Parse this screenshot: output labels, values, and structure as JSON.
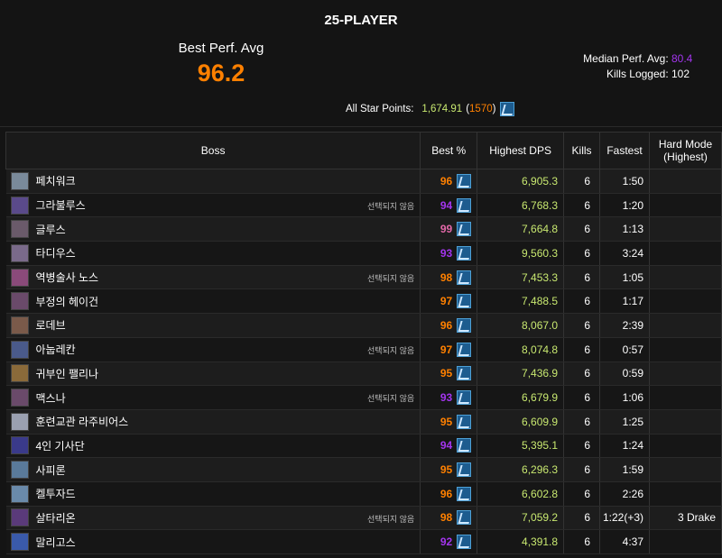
{
  "header": {
    "size_title": "25-PLAYER",
    "best_perf_label": "Best Perf. Avg",
    "best_perf_value": "96.2",
    "median_label": "Median Perf. Avg:",
    "median_value": "80.4",
    "kills_label": "Kills Logged:",
    "kills_value": "102",
    "asp_label": "All Star Points:",
    "asp_value": "1,674.91",
    "asp_open": "(",
    "asp_rank": "1570",
    "asp_close": ")"
  },
  "colors": {
    "legendary": "#ff8000",
    "epic": "#a335ee",
    "pink": "#e268a8",
    "dps_green": "#c8e870"
  },
  "table": {
    "headers": {
      "boss": "Boss",
      "best": "Best %",
      "dps": "Highest DPS",
      "kills": "Kills",
      "fastest": "Fastest",
      "hard1": "Hard Mode",
      "hard2": "(Highest)"
    },
    "rows": [
      {
        "boss": "페치워크",
        "note": "",
        "best": "96",
        "dps": "6,905.3",
        "kills": "6",
        "fastest": "1:50",
        "hard": "",
        "icon": "#7a8a9a"
      },
      {
        "boss": "그라불루스",
        "note": "선택되지 않음",
        "best": "94",
        "dps": "6,768.3",
        "kills": "6",
        "fastest": "1:20",
        "hard": "",
        "icon": "#5a4a8a"
      },
      {
        "boss": "글루스",
        "note": "",
        "best": "99",
        "dps": "7,664.8",
        "kills": "6",
        "fastest": "1:13",
        "hard": "",
        "icon": "#6a5a6a"
      },
      {
        "boss": "타디우스",
        "note": "",
        "best": "93",
        "dps": "9,560.3",
        "kills": "6",
        "fastest": "3:24",
        "hard": "",
        "icon": "#7a6a8a"
      },
      {
        "boss": "역병술사 노스",
        "note": "선택되지 않음",
        "best": "98",
        "dps": "7,453.3",
        "kills": "6",
        "fastest": "1:05",
        "hard": "",
        "icon": "#8a4a7a"
      },
      {
        "boss": "부정의 헤이건",
        "note": "",
        "best": "97",
        "dps": "7,488.5",
        "kills": "6",
        "fastest": "1:17",
        "hard": "",
        "icon": "#6a4a6a"
      },
      {
        "boss": "로데브",
        "note": "",
        "best": "96",
        "dps": "8,067.0",
        "kills": "6",
        "fastest": "2:39",
        "hard": "",
        "icon": "#7a5a4a"
      },
      {
        "boss": "아눕레칸",
        "note": "선택되지 않음",
        "best": "97",
        "dps": "8,074.8",
        "kills": "6",
        "fastest": "0:57",
        "hard": "",
        "icon": "#4a5a8a"
      },
      {
        "boss": "귀부인 팰리나",
        "note": "",
        "best": "95",
        "dps": "7,436.9",
        "kills": "6",
        "fastest": "0:59",
        "hard": "",
        "icon": "#8a6a3a"
      },
      {
        "boss": "맥스나",
        "note": "선택되지 않음",
        "best": "93",
        "dps": "6,679.9",
        "kills": "6",
        "fastest": "1:06",
        "hard": "",
        "icon": "#6a4a6a"
      },
      {
        "boss": "훈련교관 라주비어스",
        "note": "",
        "best": "95",
        "dps": "6,609.9",
        "kills": "6",
        "fastest": "1:25",
        "hard": "",
        "icon": "#9aa0b0"
      },
      {
        "boss": "4인 기사단",
        "note": "",
        "best": "94",
        "dps": "5,395.1",
        "kills": "6",
        "fastest": "1:24",
        "hard": "",
        "icon": "#3a3a8a"
      },
      {
        "boss": "사피론",
        "note": "",
        "best": "95",
        "dps": "6,296.3",
        "kills": "6",
        "fastest": "1:59",
        "hard": "",
        "icon": "#5a7a9a"
      },
      {
        "boss": "켈투자드",
        "note": "",
        "best": "96",
        "dps": "6,602.8",
        "kills": "6",
        "fastest": "2:26",
        "hard": "",
        "icon": "#6a8aaa"
      },
      {
        "boss": "살타리온",
        "note": "선택되지 않음",
        "best": "98",
        "dps": "7,059.2",
        "kills": "6",
        "fastest": "1:22(+3)",
        "hard": "3 Drake",
        "icon": "#5a3a7a"
      },
      {
        "boss": "말리고스",
        "note": "",
        "best": "92",
        "dps": "4,391.8",
        "kills": "6",
        "fastest": "4:37",
        "hard": "",
        "icon": "#3a5aaa"
      }
    ]
  }
}
